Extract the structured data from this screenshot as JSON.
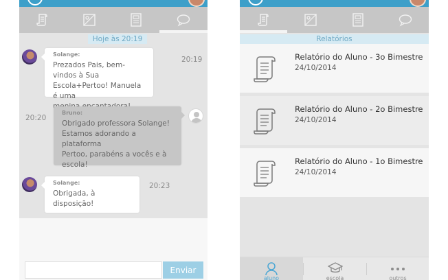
{
  "chat": {
    "date_label": "Hoje às 20:19",
    "messages": [
      {
        "sender": "Solange:",
        "lines": [
          "Prezados Pais, bem-vindos à Sua",
          "Escola+Pertoo! Manuela é uma",
          "menina encantadora!"
        ],
        "time": "20:19"
      },
      {
        "sender": "Bruno:",
        "lines": [
          "Obrigado professora Solange!",
          "Estamos adorando a plataforma",
          "Pertoo, parabéns a vocês e à",
          "escola!"
        ],
        "time": "20:20"
      },
      {
        "sender": "Solange:",
        "lines": [
          "Obrigada, à",
          "disposição!"
        ],
        "time": "20:23"
      }
    ],
    "input": {
      "value": "",
      "placeholder": ""
    },
    "send_label": "Enviar"
  },
  "reports": {
    "header": "Relatórios",
    "items": [
      {
        "title": "Relatório do Aluno - 3o Bimestre",
        "date": "24/10/2014"
      },
      {
        "title": "Relatório do Aluno - 2o Bimestre",
        "date": "24/10/2014"
      },
      {
        "title": "Relatório do Aluno - 1o Bimestre",
        "date": "24/10/2014"
      }
    ]
  },
  "bottom_nav": {
    "items": [
      {
        "label": "aluno",
        "icon": "user-icon",
        "active": true
      },
      {
        "label": "escola",
        "icon": "graduation-cap-icon",
        "active": false
      },
      {
        "label": "outros",
        "icon": "more-dots-icon",
        "active": false
      }
    ]
  },
  "colors": {
    "header_blue": "#3d9fc9",
    "accent_blue": "#4aa6d4",
    "send_button": "#9dcfe5",
    "tab_bar": "#c6c6c6"
  }
}
